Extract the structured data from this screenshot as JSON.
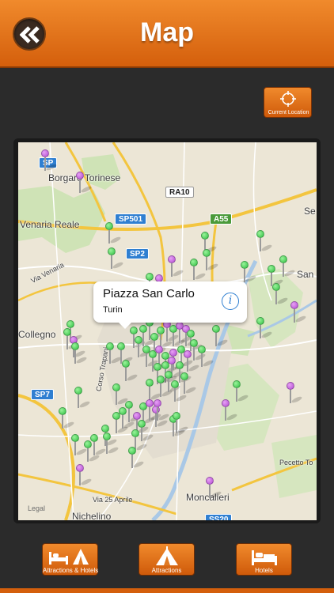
{
  "header": {
    "title": "Map"
  },
  "current_location": {
    "label": "Current Location",
    "icon": "crosshair-icon"
  },
  "map": {
    "places": [
      {
        "name": "Borgaro Torinese"
      },
      {
        "name": "Venaria Reale"
      },
      {
        "name": "Via Venaria"
      },
      {
        "name": "Collegno"
      },
      {
        "name": "Corso Trapani"
      },
      {
        "name": "Moncalieri"
      },
      {
        "name": "Nichelino"
      },
      {
        "name": "Via 25 Aprile"
      },
      {
        "name": "Pecetto To"
      },
      {
        "name": "San"
      },
      {
        "name": "Se"
      }
    ],
    "road_labels": [
      "RA10",
      "A55",
      "SP501",
      "SP2",
      "SP7",
      "SS20",
      "SP"
    ],
    "callout": {
      "title": "Piazza San Carlo",
      "subtitle": "Turin",
      "info_icon": "info-icon"
    },
    "legal": "Legal"
  },
  "tabs": [
    {
      "label": "Attractions & Hotels",
      "icon": "bed-tent-icon"
    },
    {
      "label": "Attractions",
      "icon": "tent-icon"
    },
    {
      "label": "Hotels",
      "icon": "bed-icon"
    }
  ],
  "colors": {
    "accent": "#e8731c",
    "background": "#2b2b2b",
    "pin_green": "#2fbf42",
    "pin_purple": "#b24ad1"
  }
}
